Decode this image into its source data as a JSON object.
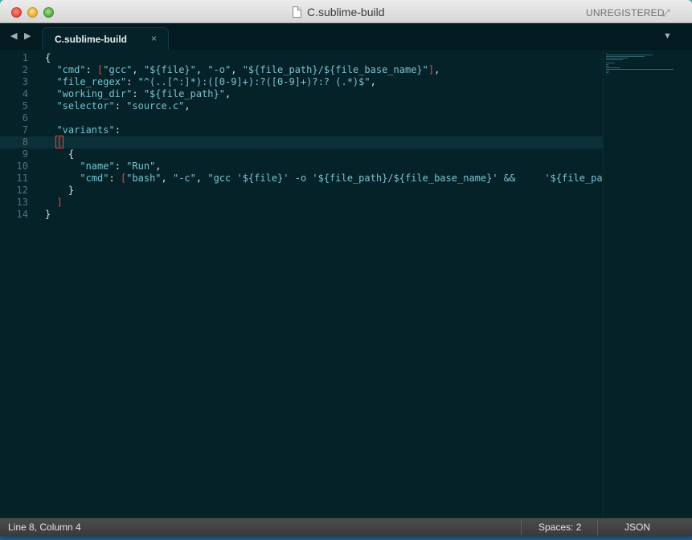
{
  "window": {
    "title": "C.sublime-build",
    "registration": "UNREGISTERED",
    "fullscreen_glyph": "⤢"
  },
  "tabs": {
    "back_glyph": "◀",
    "forward_glyph": "▶",
    "active_label": "C.sublime-build",
    "close_glyph": "×",
    "dropdown_glyph": "▼"
  },
  "editor": {
    "active_line": 8,
    "lines": [
      {
        "n": "1",
        "tokens": [
          {
            "t": "p",
            "v": "{"
          }
        ]
      },
      {
        "n": "2",
        "tokens": [
          {
            "t": "p",
            "v": "  "
          },
          {
            "t": "k",
            "v": "\"cmd\""
          },
          {
            "t": "p",
            "v": ": "
          },
          {
            "t": "b",
            "v": "["
          },
          {
            "t": "s",
            "v": "\"gcc\""
          },
          {
            "t": "p",
            "v": ", "
          },
          {
            "t": "s",
            "v": "\"${file}\""
          },
          {
            "t": "p",
            "v": ", "
          },
          {
            "t": "s",
            "v": "\"-o\""
          },
          {
            "t": "p",
            "v": ", "
          },
          {
            "t": "s",
            "v": "\"${file_path}/${file_base_name}\""
          },
          {
            "t": "b",
            "v": "]"
          },
          {
            "t": "p",
            "v": ","
          }
        ]
      },
      {
        "n": "3",
        "tokens": [
          {
            "t": "p",
            "v": "  "
          },
          {
            "t": "k",
            "v": "\"file_regex\""
          },
          {
            "t": "p",
            "v": ": "
          },
          {
            "t": "s",
            "v": "\"^(..[^:]*):([0-9]+):?([0-9]+)?:? (.*)$\""
          },
          {
            "t": "p",
            "v": ","
          }
        ]
      },
      {
        "n": "4",
        "tokens": [
          {
            "t": "p",
            "v": "  "
          },
          {
            "t": "k",
            "v": "\"working_dir\""
          },
          {
            "t": "p",
            "v": ": "
          },
          {
            "t": "s",
            "v": "\"${file_path}\""
          },
          {
            "t": "p",
            "v": ","
          }
        ]
      },
      {
        "n": "5",
        "tokens": [
          {
            "t": "p",
            "v": "  "
          },
          {
            "t": "k",
            "v": "\"selector\""
          },
          {
            "t": "p",
            "v": ": "
          },
          {
            "t": "s",
            "v": "\"source.c\""
          },
          {
            "t": "p",
            "v": ","
          }
        ]
      },
      {
        "n": "6",
        "tokens": [
          {
            "t": "p",
            "v": ""
          }
        ]
      },
      {
        "n": "7",
        "tokens": [
          {
            "t": "p",
            "v": "  "
          },
          {
            "t": "k",
            "v": "\"variants\""
          },
          {
            "t": "p",
            "v": ":"
          }
        ]
      },
      {
        "n": "8",
        "tokens": [
          {
            "t": "p",
            "v": "  "
          },
          {
            "t": "c",
            "v": "["
          }
        ]
      },
      {
        "n": "9",
        "tokens": [
          {
            "t": "p",
            "v": "    {"
          }
        ]
      },
      {
        "n": "10",
        "tokens": [
          {
            "t": "p",
            "v": "      "
          },
          {
            "t": "k",
            "v": "\"name\""
          },
          {
            "t": "p",
            "v": ": "
          },
          {
            "t": "s",
            "v": "\"Run\""
          },
          {
            "t": "p",
            "v": ","
          }
        ]
      },
      {
        "n": "11",
        "tokens": [
          {
            "t": "p",
            "v": "      "
          },
          {
            "t": "k",
            "v": "\"cmd\""
          },
          {
            "t": "p",
            "v": ": "
          },
          {
            "t": "b",
            "v": "["
          },
          {
            "t": "s",
            "v": "\"bash\""
          },
          {
            "t": "p",
            "v": ", "
          },
          {
            "t": "s",
            "v": "\"-c\""
          },
          {
            "t": "p",
            "v": ", "
          },
          {
            "t": "s",
            "v": "\"gcc '${file}' -o '${file_path}/${file_base_name}' &&     '${file_path}"
          }
        ]
      },
      {
        "n": "12",
        "tokens": [
          {
            "t": "p",
            "v": "    }"
          }
        ]
      },
      {
        "n": "13",
        "tokens": [
          {
            "t": "p",
            "v": "  "
          },
          {
            "t": "b",
            "v": "]"
          }
        ]
      },
      {
        "n": "14",
        "tokens": [
          {
            "t": "p",
            "v": "}"
          }
        ]
      }
    ]
  },
  "status": {
    "position": "Line 8, Column 4",
    "spaces": "Spaces: 2",
    "syntax": "JSON"
  },
  "colors": {
    "background": "#062229",
    "key": "#6fc5d0",
    "string": "#79c3cf",
    "bracket": "#e8453c",
    "text": "#d8e3e6",
    "gutter": "#56707a"
  }
}
